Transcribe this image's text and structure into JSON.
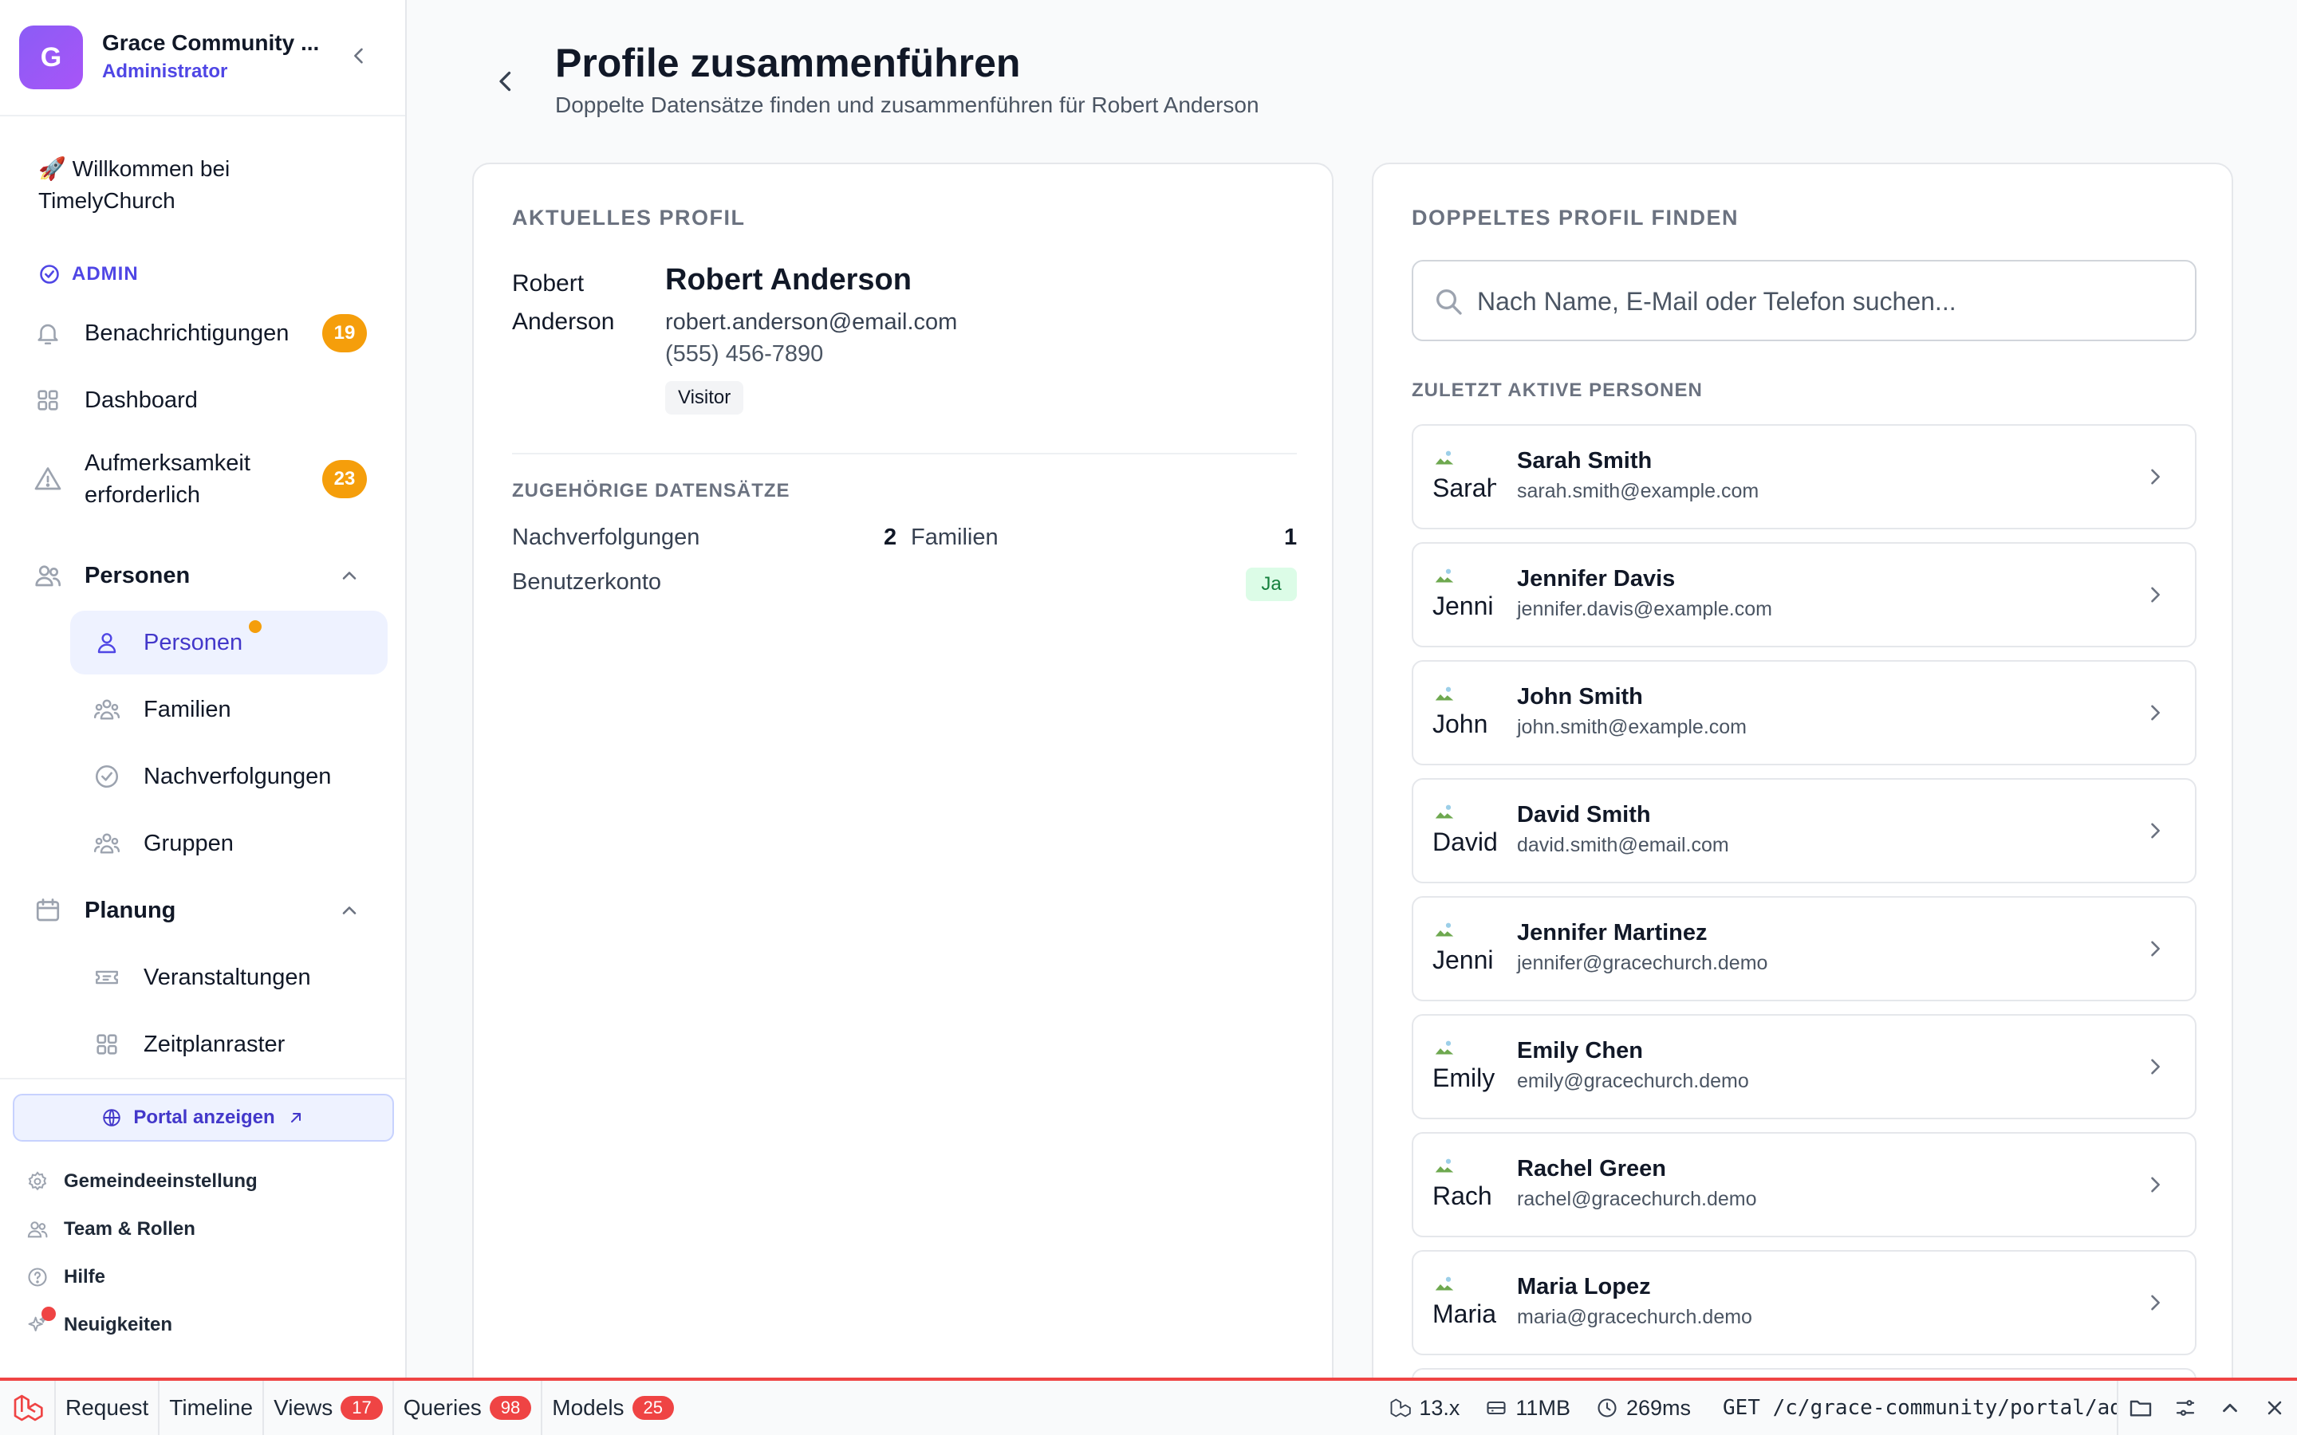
{
  "org": {
    "initial": "G",
    "name": "Grace Community ...",
    "role": "Administrator"
  },
  "sidebar": {
    "welcome": "🚀 Willkommen bei TimelyChurch",
    "section_admin": "ADMIN",
    "items": [
      {
        "label": "Benachrichtigungen",
        "badge": "19",
        "icon": "bell-icon"
      },
      {
        "label": "Dashboard",
        "icon": "dashboard-grid-icon"
      },
      {
        "label": "Aufmerksamkeit erforderlich",
        "badge": "23",
        "icon": "warning-icon"
      }
    ],
    "groups": [
      {
        "label": "Personen",
        "icon": "people-icon",
        "expanded": true,
        "children": [
          {
            "label": "Personen",
            "icon": "person-icon",
            "active": true,
            "dot": true
          },
          {
            "label": "Familien",
            "icon": "family-icon"
          },
          {
            "label": "Nachverfolgungen",
            "icon": "check-circle-icon"
          },
          {
            "label": "Gruppen",
            "icon": "groups-icon"
          }
        ]
      },
      {
        "label": "Planung",
        "icon": "calendar-icon",
        "expanded": true,
        "children": [
          {
            "label": "Veranstaltungen",
            "icon": "ticket-icon"
          },
          {
            "label": "Zeitplanraster",
            "icon": "grid-icon"
          }
        ]
      }
    ],
    "portal_button": "Portal anzeigen",
    "utility": [
      {
        "label": "Gemeindeeinstellung",
        "icon": "gear-icon"
      },
      {
        "label": "Team & Rollen",
        "icon": "team-icon"
      },
      {
        "label": "Hilfe",
        "icon": "help-icon"
      },
      {
        "label": "Neuigkeiten",
        "icon": "sparkle-icon",
        "notification_dot": true
      }
    ]
  },
  "page": {
    "title": "Profile zusammenführen",
    "subtitle": "Doppelte Datensätze finden und zusammenführen für Robert Anderson"
  },
  "current_profile": {
    "label": "AKTUELLES PROFIL",
    "avatar_alt": "Robert Anderson",
    "name": "Robert Anderson",
    "email": "robert.anderson@email.com",
    "phone": "(555) 456-7890",
    "status": "Visitor",
    "related_label": "ZUGEHÖRIGE DATENSÄTZE",
    "related": {
      "followups_label": "Nachverfolgungen",
      "followups_value": "2",
      "families_label": "Familien",
      "families_value": "1",
      "account_label": "Benutzerkonto",
      "account_value": "Ja"
    }
  },
  "duplicate_finder": {
    "label": "DOPPELTES PROFIL FINDEN",
    "search_placeholder": "Nach Name, E-Mail oder Telefon suchen...",
    "recent_label": "ZULETZT AKTIVE PERSONEN",
    "people": [
      {
        "avatar_alt": "Sarah",
        "name": "Sarah Smith",
        "email": "sarah.smith@example.com"
      },
      {
        "avatar_alt": "Jenni",
        "name": "Jennifer Davis",
        "email": "jennifer.davis@example.com"
      },
      {
        "avatar_alt": "John",
        "name": "John Smith",
        "email": "john.smith@example.com"
      },
      {
        "avatar_alt": "David",
        "name": "David Smith",
        "email": "david.smith@email.com"
      },
      {
        "avatar_alt": "Jenni",
        "name": "Jennifer Martinez",
        "email": "jennifer@gracechurch.demo"
      },
      {
        "avatar_alt": "Emily",
        "name": "Emily Chen",
        "email": "emily@gracechurch.demo"
      },
      {
        "avatar_alt": "Rach",
        "name": "Rachel Green",
        "email": "rachel@gracechurch.demo"
      },
      {
        "avatar_alt": "Maria",
        "name": "Maria Lopez",
        "email": "maria@gracechurch.demo"
      }
    ]
  },
  "debugbar": {
    "tabs": [
      {
        "label": "Request"
      },
      {
        "label": "Timeline"
      },
      {
        "label": "Views",
        "count": "17"
      },
      {
        "label": "Queries",
        "count": "98"
      },
      {
        "label": "Models",
        "count": "25"
      }
    ],
    "version": "13.x",
    "memory": "11MB",
    "duration": "269ms",
    "request": "GET /c/grace-community/portal/adm…",
    "accent": "#ef4444"
  }
}
